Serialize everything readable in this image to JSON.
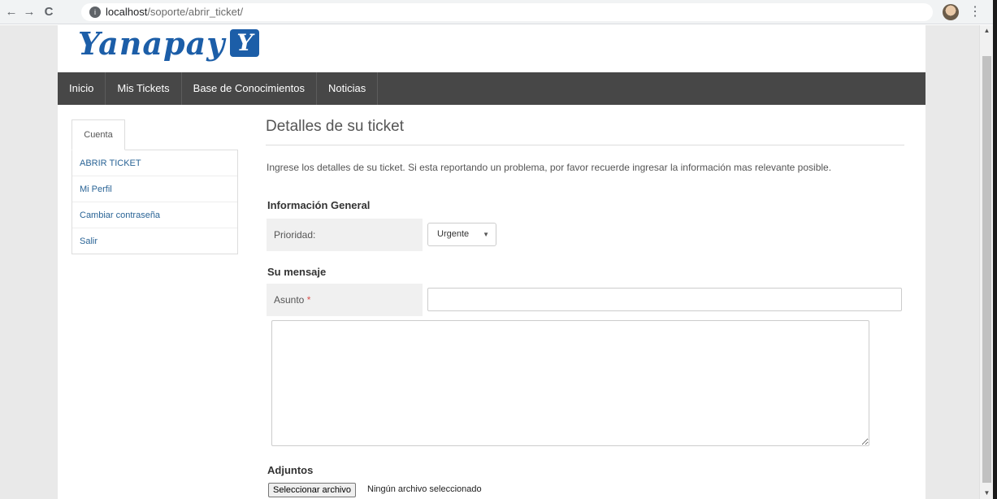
{
  "browser": {
    "back_icon": "←",
    "forward_icon": "→",
    "reload_icon": "C",
    "url_host": "localhost",
    "url_path": "/soporte/abrir_ticket/",
    "menu_icon": "⋮"
  },
  "header": {
    "logo_text": "Yanapay",
    "logo_mark": "Y"
  },
  "main_nav": {
    "items": [
      {
        "label": "Inicio"
      },
      {
        "label": "Mis Tickets"
      },
      {
        "label": "Base de Conocimientos"
      },
      {
        "label": "Noticias"
      }
    ]
  },
  "sidebar": {
    "tab_label": "Cuenta",
    "items": [
      {
        "label": "ABRIR TICKET"
      },
      {
        "label": "Mi Perfil"
      },
      {
        "label": "Cambiar contraseña"
      },
      {
        "label": "Salir"
      }
    ]
  },
  "content": {
    "title": "Detalles de su ticket",
    "intro": "Ingrese los detalles de su ticket. Si esta reportando un problema, por favor recuerde ingresar la información mas relevante posible.",
    "general_section": "Información General",
    "priority_label": "Prioridad:",
    "priority_value": "Urgente",
    "message_section": "Su mensaje",
    "subject_label": "Asunto",
    "required_mark": "*",
    "subject_value": "",
    "message_value": "",
    "attachments_section": "Adjuntos",
    "file_button": "Seleccionar archivo",
    "file_status": "Ningún archivo seleccionado"
  },
  "colors": {
    "brand": "#1c5ea8",
    "nav_bg": "#474747",
    "link": "#2a6496",
    "required": "#d9534f"
  }
}
